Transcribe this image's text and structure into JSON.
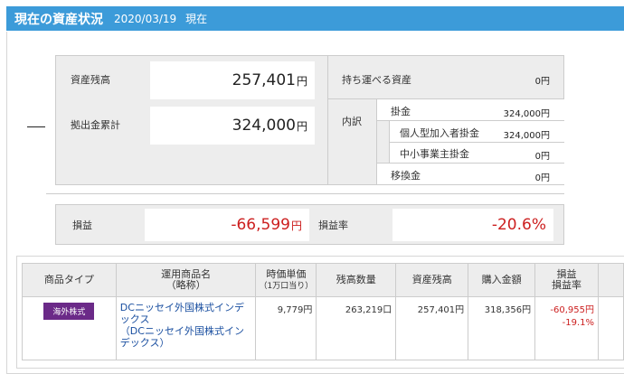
{
  "header": {
    "title": "現在の資産状況",
    "date": "2020/03/19",
    "now": "現在"
  },
  "summary": {
    "asset_balance_label": "資産残高",
    "asset_balance_value": "257,401",
    "contrib_total_label": "拠出金累計",
    "contrib_total_value": "324,000",
    "yen": "円",
    "portable_label": "持ち運べる資産",
    "portable_value": "0円",
    "breakdown_label": "内訳",
    "kakekin_label": "掛金",
    "kakekin_value": "324,000円",
    "individual_label": "個人型加入者掛金",
    "individual_value": "324,000円",
    "sme_label": "中小事業主掛金",
    "sme_value": "0円",
    "transfer_label": "移換金",
    "transfer_value": "0円"
  },
  "profit": {
    "label": "損益",
    "value": "-66,599",
    "rate_label": "損益率",
    "rate_value": "-20.6%"
  },
  "table": {
    "headers": {
      "type": "商品タイプ",
      "name_1": "運用商品名",
      "name_2": "（略称）",
      "price_1": "時価単価",
      "price_2": "（1万口当り）",
      "qty": "残高数量",
      "balance": "資産残高",
      "purchase": "購入金額",
      "pl_1": "損益",
      "pl_2": "損益率"
    },
    "row": {
      "type": "海外株式",
      "name": "DCニッセイ外国株式インデックス",
      "short": "（DCニッセイ外国株式インデックス）",
      "price": "9,779円",
      "qty": "263,219口",
      "balance": "257,401円",
      "purchase": "318,356円",
      "pl": "-60,955円",
      "pl_rate": "-19.1%"
    }
  }
}
